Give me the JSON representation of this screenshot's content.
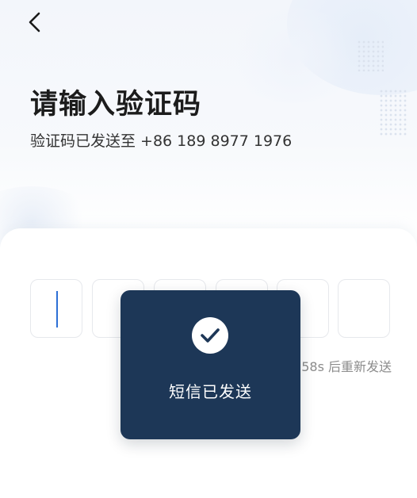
{
  "header": {
    "back_icon": "chevron-left-icon"
  },
  "verify": {
    "title": "请输入验证码",
    "subtitle": "验证码已发送至 +86 189 8977 1976",
    "code_digits": [
      "",
      "",
      "",
      "",
      "",
      ""
    ],
    "resend_text": "58s 后重新发送"
  },
  "toast": {
    "icon": "check-circle-icon",
    "message": "短信已发送"
  },
  "colors": {
    "toast_background": "#1d3757",
    "caret": "#2d6fd6",
    "title_text": "#1c1c1c",
    "muted_text": "#8c8c8c"
  }
}
